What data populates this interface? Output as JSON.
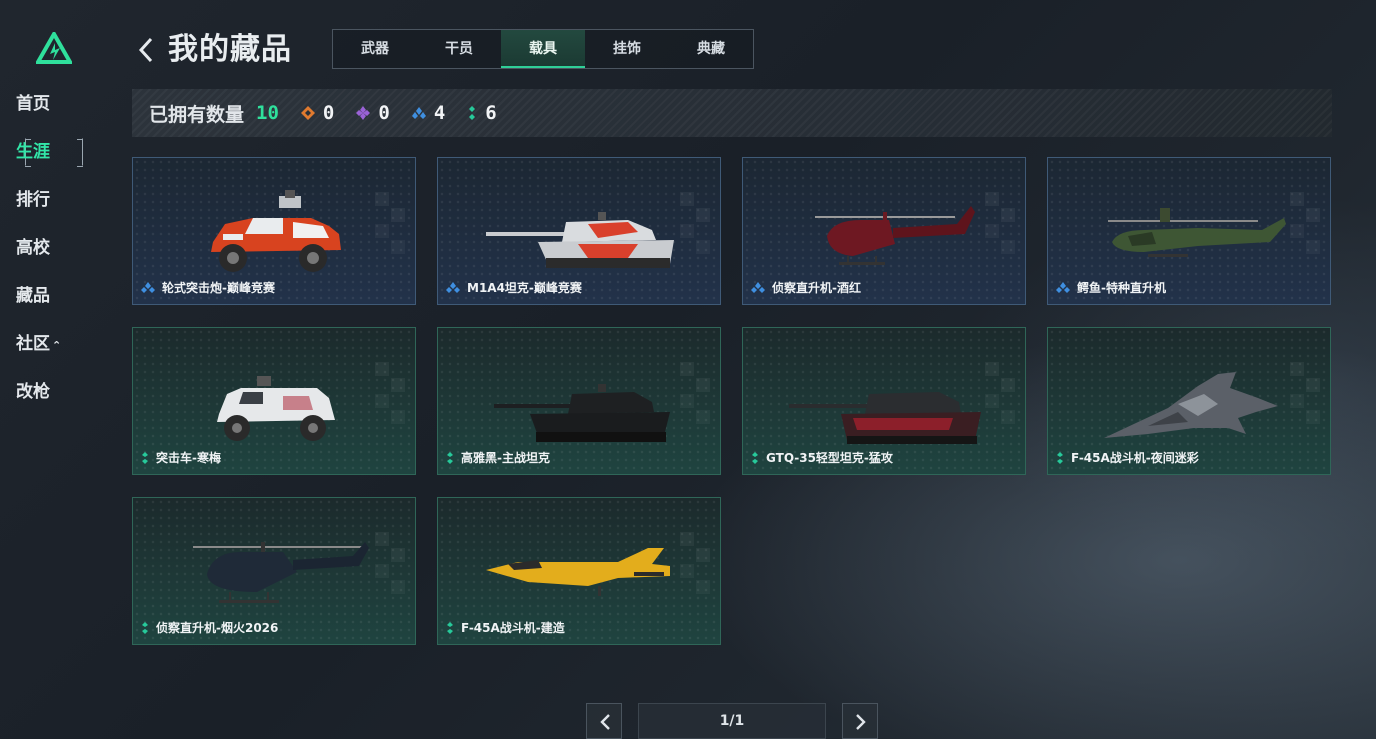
{
  "sidebar": {
    "items": [
      {
        "label": "首页"
      },
      {
        "label": "生涯"
      },
      {
        "label": "排行"
      },
      {
        "label": "高校"
      },
      {
        "label": "藏品"
      },
      {
        "label": "社区"
      },
      {
        "label": "改枪"
      }
    ],
    "active_index": 1,
    "community_caret": "⌃"
  },
  "header": {
    "title": "我的藏品",
    "tabs": [
      {
        "label": "武器"
      },
      {
        "label": "干员"
      },
      {
        "label": "载具"
      },
      {
        "label": "挂饰"
      },
      {
        "label": "典藏"
      }
    ],
    "active_tab": "载具"
  },
  "summary": {
    "label": "已拥有数量",
    "total": "10",
    "rarities": [
      {
        "icon": "orange-diamond-icon",
        "color": "#e07a2f",
        "count": "0"
      },
      {
        "icon": "purple-diamond-icon",
        "color": "#9a62d6",
        "count": "0"
      },
      {
        "icon": "blue-diamond-icon",
        "color": "#3f8fe0",
        "count": "4"
      },
      {
        "icon": "green-diamond-icon",
        "color": "#27c99a",
        "count": "6"
      }
    ]
  },
  "items": [
    {
      "name": "轮式突击炮-巅峰竞赛",
      "rarity": "blue",
      "art": "armored-car-icon"
    },
    {
      "name": "M1A4坦克-巅峰竞赛",
      "rarity": "blue",
      "art": "tank-icon"
    },
    {
      "name": "侦察直升机-酒红",
      "rarity": "blue",
      "art": "helicopter-icon"
    },
    {
      "name": "鳄鱼-特种直升机",
      "rarity": "blue",
      "art": "attack-helicopter-icon"
    },
    {
      "name": "突击车-寒梅",
      "rarity": "green",
      "art": "armored-car-icon"
    },
    {
      "name": "高雅黑-主战坦克",
      "rarity": "green",
      "art": "tank-icon"
    },
    {
      "name": "GTQ-35轻型坦克-猛攻",
      "rarity": "green",
      "art": "tank-icon"
    },
    {
      "name": "F-45A战斗机-夜间迷彩",
      "rarity": "green",
      "art": "fighter-jet-icon"
    },
    {
      "name": "侦察直升机-烟火2026",
      "rarity": "green",
      "art": "helicopter-icon"
    },
    {
      "name": "F-45A战斗机-建造",
      "rarity": "green",
      "art": "fighter-jet-icon"
    }
  ],
  "pager": {
    "indicator": "1/1"
  },
  "colors": {
    "accent": "#2fe09c",
    "blue_rarity": "#3f8fe0",
    "green_rarity": "#27c99a"
  }
}
